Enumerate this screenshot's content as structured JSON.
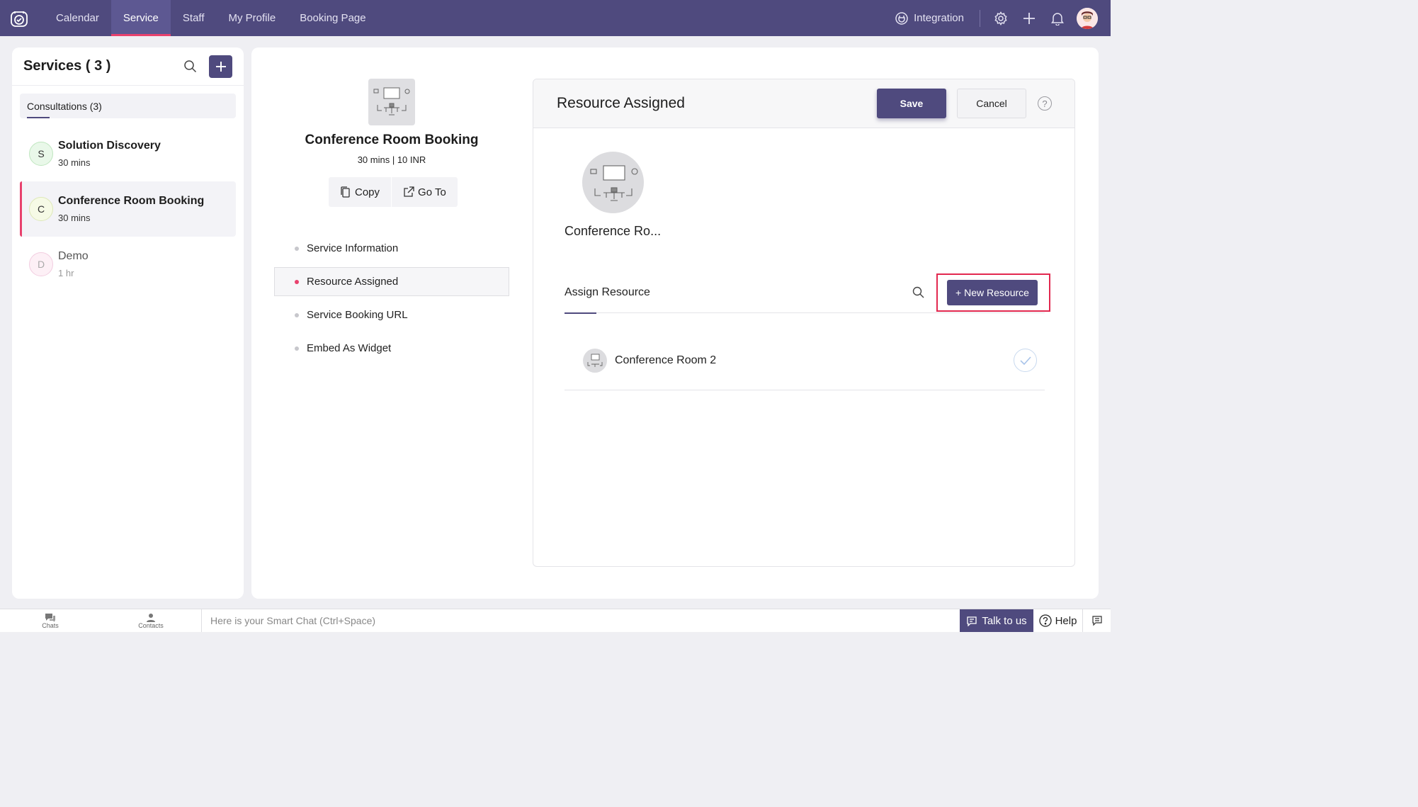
{
  "colors": {
    "brand": "#4f4a7e",
    "accent": "#e8416d",
    "highlight": "#e2284f"
  },
  "topnav": {
    "items": [
      {
        "label": "Calendar",
        "active": false
      },
      {
        "label": "Service",
        "active": true
      },
      {
        "label": "Staff",
        "active": false
      },
      {
        "label": "My Profile",
        "active": false
      },
      {
        "label": "Booking Page",
        "active": false
      }
    ],
    "integration_label": "Integration",
    "icons": [
      "settings-icon",
      "plus-icon",
      "bell-icon",
      "avatar"
    ]
  },
  "sidebar": {
    "title": "Services ( 3 )",
    "category": "Consultations (3)",
    "services": [
      {
        "initial": "S",
        "name": "Solution Discovery",
        "duration": "30 mins",
        "avatar_color": "#e9f8e9",
        "avatar_border": "#bfe6bf"
      },
      {
        "initial": "C",
        "name": "Conference Room Booking",
        "duration": "30 mins",
        "avatar_color": "#f6fae6",
        "avatar_border": "#dde8b8"
      },
      {
        "initial": "D",
        "name": "Demo",
        "duration": "1 hr",
        "avatar_color": "#fdf0f6",
        "avatar_border": "#f2cde0"
      }
    ]
  },
  "service_summary": {
    "title": "Conference Room Booking",
    "meta": "30 mins | 10 INR",
    "copy_label": "Copy",
    "goto_label": "Go To"
  },
  "menu": {
    "items": [
      {
        "label": "Service Information",
        "active": false
      },
      {
        "label": "Resource Assigned",
        "active": true
      },
      {
        "label": "Service Booking URL",
        "active": false
      },
      {
        "label": "Embed As Widget",
        "active": false
      }
    ]
  },
  "resource_card": {
    "title": "Resource Assigned",
    "save_label": "Save",
    "cancel_label": "Cancel",
    "help_label": "?",
    "resource_name": "Conference Ro...",
    "assign_label": "Assign Resource",
    "new_resource_label": "+ New Resource",
    "resources": [
      {
        "name": "Conference Room 2",
        "selected": true
      }
    ]
  },
  "bottombar": {
    "chats_label": "Chats",
    "contacts_label": "Contacts",
    "smartchat_placeholder": "Here is your Smart Chat (Ctrl+Space)",
    "talk_label": "Talk to us",
    "help_label": "Help"
  }
}
